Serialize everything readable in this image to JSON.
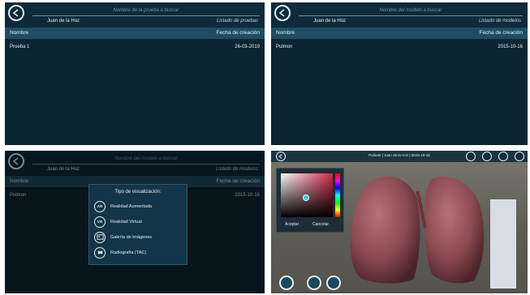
{
  "panel1": {
    "search_placeholder": "Nombre de la prueba a buscar",
    "user": "Juan de la Hoz",
    "list_title": "Listado de pruebas",
    "columns": {
      "name": "Nombre",
      "date": "Fecha de creación"
    },
    "rows": [
      {
        "name": "Prueba 1",
        "date": "26-03-2019"
      }
    ]
  },
  "panel2": {
    "search_placeholder": "Nombre del modelo a buscar",
    "user": "Juan de la Hoz",
    "list_title": "Listado de modelos",
    "columns": {
      "name": "Nombre",
      "date": "Fecha de creación"
    },
    "rows": [
      {
        "name": "Pulmon",
        "date": "2015-10-16"
      }
    ]
  },
  "panel3": {
    "search_placeholder": "Nombre del modelo a buscar",
    "user": "Juan de la Hoz",
    "list_title": "Listado de modelos",
    "columns": {
      "name": "Nombre",
      "date": "Fecha de creación"
    },
    "rows": [
      {
        "name": "Pulmon",
        "date": "2015-10-16"
      }
    ],
    "modal": {
      "title": "Tipo de visualización:",
      "options": [
        {
          "icon_text": "AR",
          "icon": "ar-icon",
          "label": "Realidad Aumentada"
        },
        {
          "icon_text": "VR",
          "icon": "vr-icon",
          "label": "Realidad Virtual"
        },
        {
          "icon_text": "",
          "icon": "gallery-icon",
          "label": "Galería de imágenes"
        },
        {
          "icon_text": "",
          "icon": "xray-icon",
          "label": "Radiografía (TAC)"
        }
      ]
    }
  },
  "panel4": {
    "title": "Pulmon | Juan de la Hoz | 2015-10-16",
    "toolbar_icons": [
      "palette-icon",
      "paint-bucket-icon",
      "pencil-icon",
      "camera-icon"
    ],
    "picker": {
      "accept": "Aceptar",
      "cancel": "Cancelar"
    },
    "zoom_icons": [
      "move-icon",
      "zoom-in-icon",
      "zoom-out-icon"
    ]
  },
  "colors": {
    "panel_bg": "#0b2532",
    "header_row": "#1f4e63",
    "text": "#e6eef2",
    "lung": "#8a4a50"
  }
}
